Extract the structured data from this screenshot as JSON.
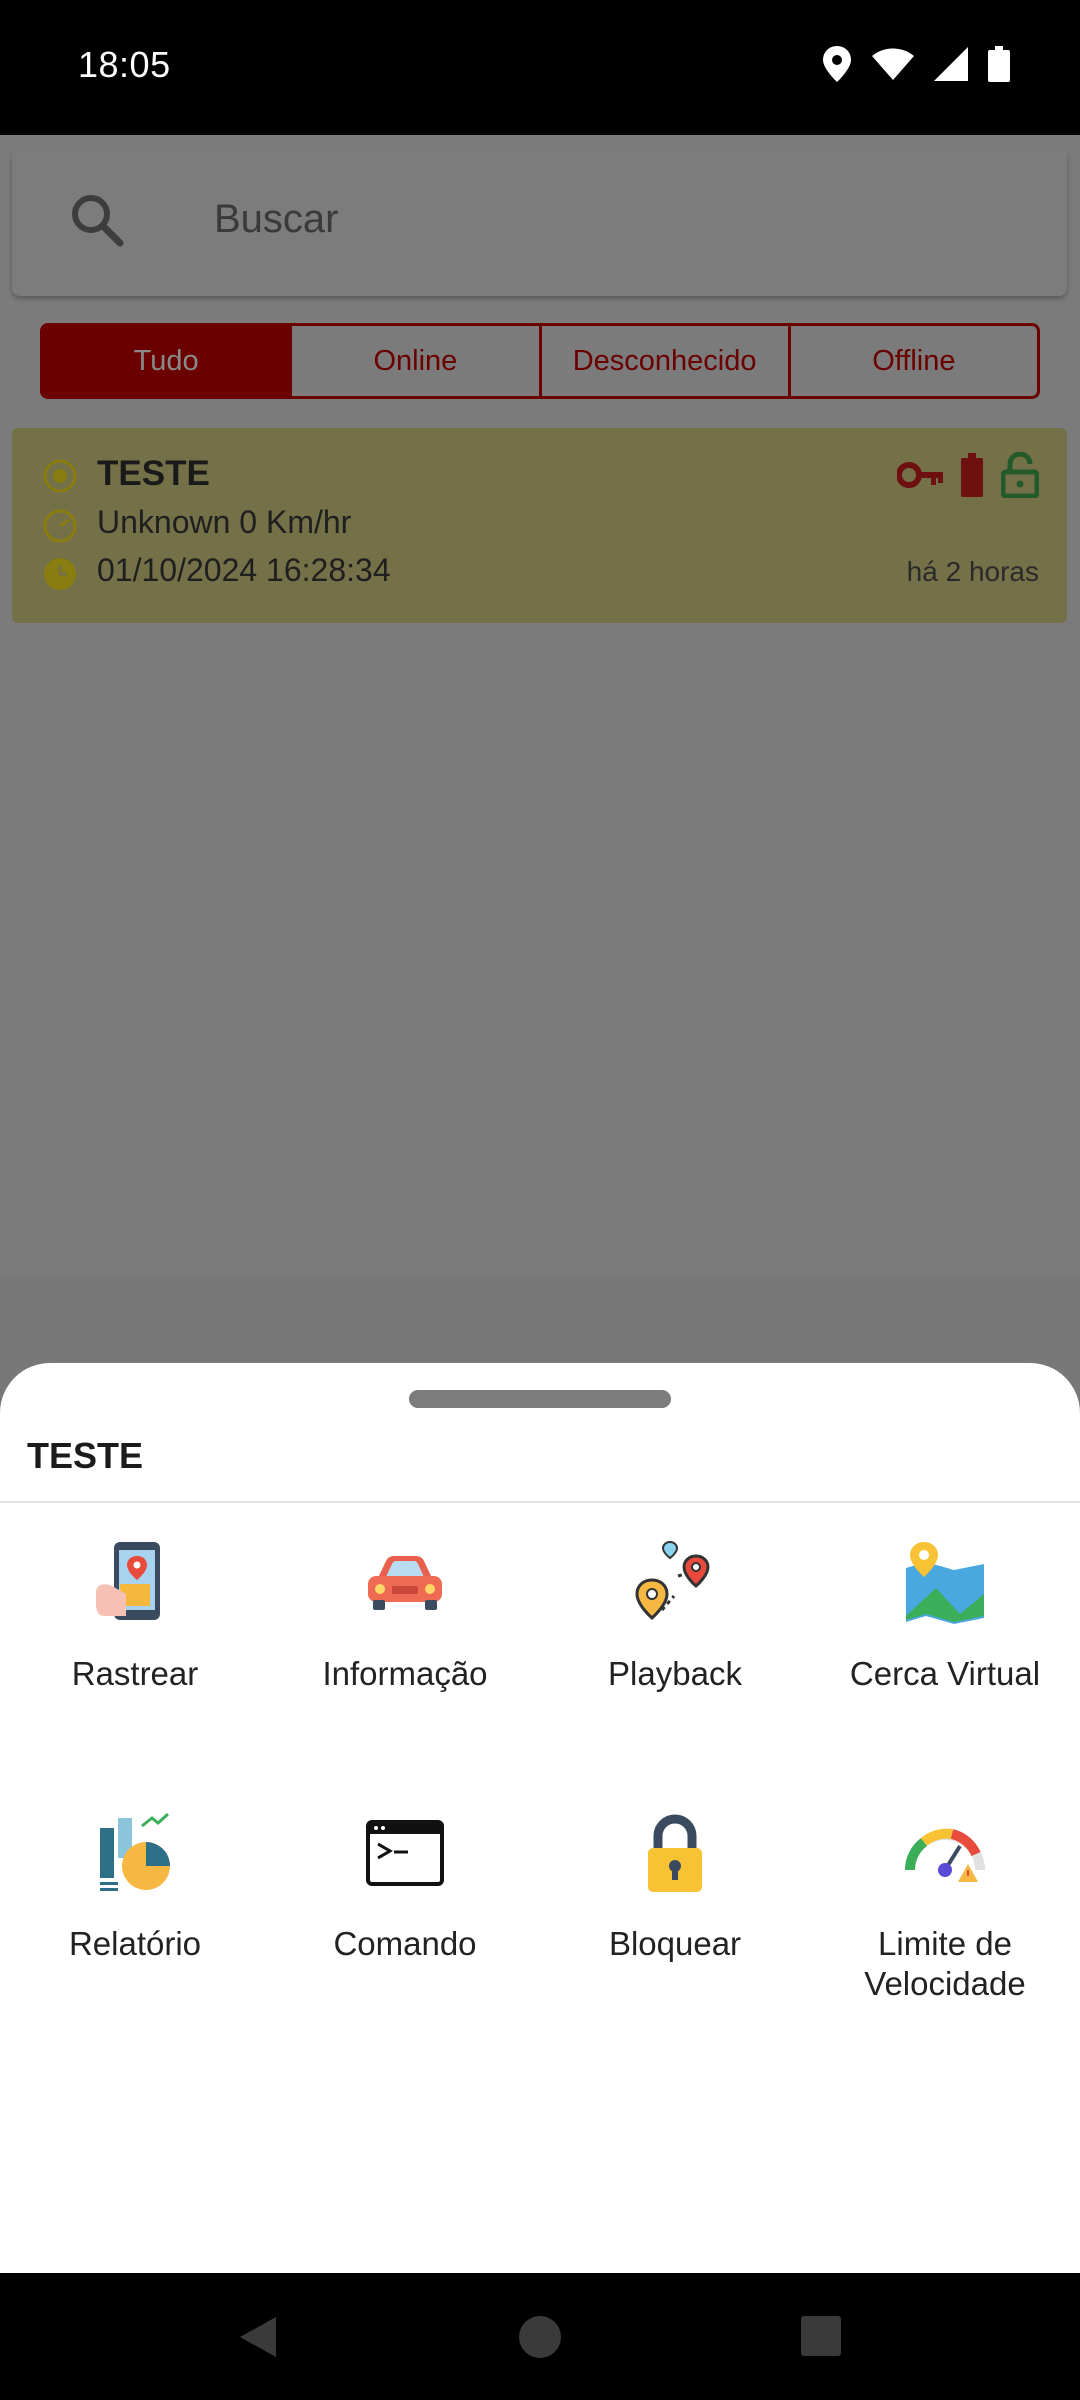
{
  "status_bar": {
    "time": "18:05",
    "icons": [
      "location-icon",
      "wifi-icon",
      "signal-icon",
      "battery-icon"
    ]
  },
  "search": {
    "placeholder": "Buscar"
  },
  "filter_tabs": [
    {
      "label": "Tudo",
      "active": true
    },
    {
      "label": "Online",
      "active": false
    },
    {
      "label": "Desconhecido",
      "active": false
    },
    {
      "label": "Offline",
      "active": false
    }
  ],
  "device": {
    "name": "TESTE",
    "status_speed": "Unknown 0 Km/hr",
    "datetime": "01/10/2024 16:28:34",
    "ago": "há 2 horas",
    "icons": [
      "key-icon",
      "battery-icon",
      "lock-open-icon"
    ]
  },
  "sheet": {
    "title": "TESTE",
    "actions": [
      {
        "label": "Rastrear",
        "icon": "track-phone-icon"
      },
      {
        "label": "Informação",
        "icon": "car-icon"
      },
      {
        "label": "Playback",
        "icon": "route-pins-icon"
      },
      {
        "label": "Cerca Virtual",
        "icon": "geofence-map-icon"
      },
      {
        "label": "Relatório",
        "icon": "report-chart-icon"
      },
      {
        "label": "Comando",
        "icon": "terminal-icon"
      },
      {
        "label": "Bloquear",
        "icon": "padlock-icon"
      },
      {
        "label": "Limite de Velocidade",
        "icon": "speedometer-icon"
      }
    ]
  },
  "colors": {
    "brand_red": "#6a0000",
    "overlay_gray": "#7b7b7b",
    "card_tint": "#747047"
  }
}
